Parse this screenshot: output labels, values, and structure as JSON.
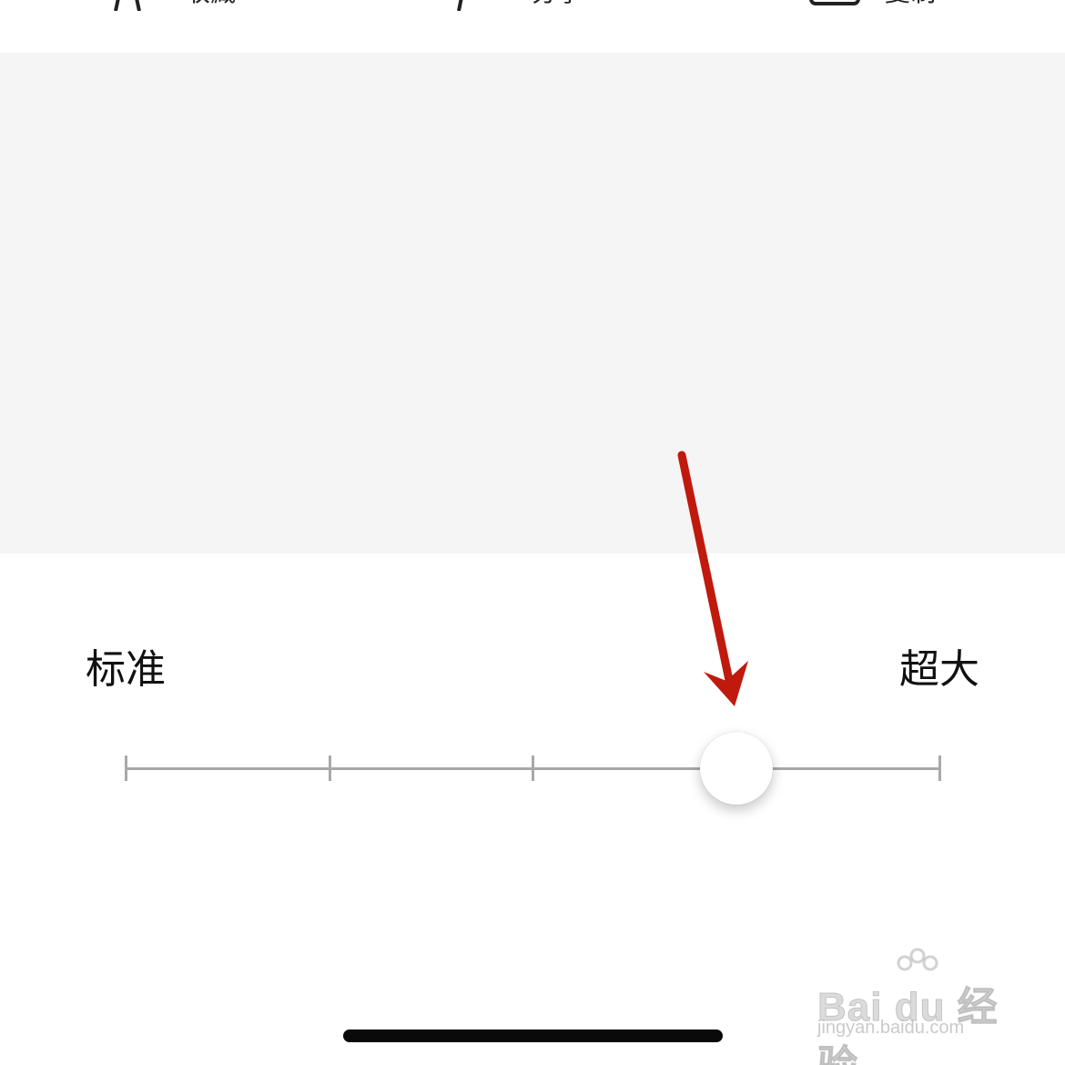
{
  "toolbar": {
    "items": [
      {
        "icon": "star-icon",
        "label": "收藏"
      },
      {
        "icon": "share-icon",
        "label": "分享"
      },
      {
        "icon": "copy-icon",
        "label": "复制"
      }
    ]
  },
  "font_size_setting": {
    "min_label": "标准",
    "max_label": "超大",
    "steps": 5,
    "selected_step": 4
  },
  "annotation": {
    "arrow_color": "#c0190e"
  },
  "watermark": {
    "logo_text": "Bai du 经验",
    "url": "jingyan.baidu.com"
  }
}
